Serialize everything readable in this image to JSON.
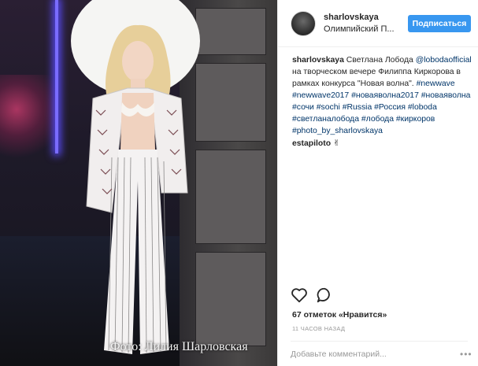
{
  "post": {
    "author": "sharlovskaya",
    "location": "Олимпийский П...",
    "follow_label": "Подписаться",
    "photo_caption": "Фото: Лилия Шарловская",
    "text_segments": [
      {
        "text": "Светлана Лобода ",
        "type": "plain"
      },
      {
        "text": "@lobodaofficial",
        "type": "link"
      },
      {
        "text": " на творческом вечере Филиппа Киркорова в рамках конкурса \"Новая волна\". ",
        "type": "plain"
      },
      {
        "text": "#newwave",
        "type": "link"
      },
      {
        "text": " ",
        "type": "plain"
      },
      {
        "text": "#newwave2017",
        "type": "link"
      },
      {
        "text": " ",
        "type": "plain"
      },
      {
        "text": "#новаяволна2017",
        "type": "link"
      },
      {
        "text": " ",
        "type": "plain"
      },
      {
        "text": "#новаяволна",
        "type": "link"
      },
      {
        "text": " ",
        "type": "plain"
      },
      {
        "text": "#сочи",
        "type": "link"
      },
      {
        "text": " ",
        "type": "plain"
      },
      {
        "text": "#sochi",
        "type": "link"
      },
      {
        "text": " ",
        "type": "plain"
      },
      {
        "text": "#Russia",
        "type": "link"
      },
      {
        "text": " ",
        "type": "plain"
      },
      {
        "text": "#Россия",
        "type": "link"
      },
      {
        "text": " ",
        "type": "plain"
      },
      {
        "text": "#loboda",
        "type": "link"
      },
      {
        "text": " ",
        "type": "plain"
      },
      {
        "text": "#светланалобода",
        "type": "link"
      },
      {
        "text": " ",
        "type": "plain"
      },
      {
        "text": "#лобода",
        "type": "link"
      },
      {
        "text": " ",
        "type": "plain"
      },
      {
        "text": "#киркоров",
        "type": "link"
      },
      {
        "text": " ",
        "type": "plain"
      },
      {
        "text": "#photo_by_sharlovskaya",
        "type": "link"
      }
    ],
    "comment": {
      "author": "estapiloto",
      "text": "✌"
    },
    "likes_count": "67",
    "likes_label": "отметок «Нравится»",
    "time_ago": "11 ЧАСОВ НАЗАД",
    "comment_placeholder": "Добавьте комментарий...",
    "more_label": "•••"
  },
  "icons": {
    "like": "heart-icon",
    "comment": "speech-bubble-icon",
    "avatar": "profile-avatar"
  },
  "colors": {
    "follow_button": "#3897f0",
    "link": "#003569",
    "muted": "#999999",
    "divider": "#efefef"
  }
}
